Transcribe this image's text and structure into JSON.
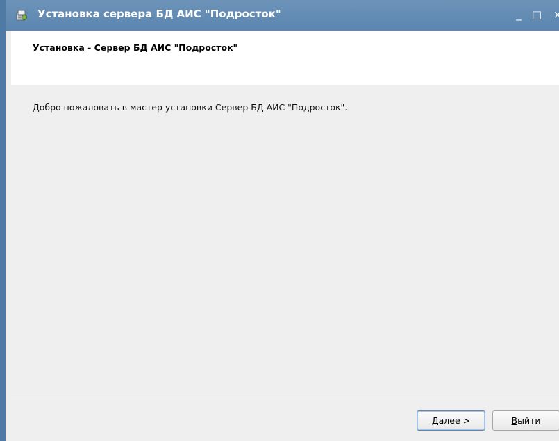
{
  "window": {
    "title": "Установка сервера БД АИС \"Подросток\"",
    "controls": {
      "minimize": "_",
      "maximize": "□",
      "close": "×"
    },
    "icon": "installer-app-icon"
  },
  "header": {
    "title": "Установка - Сервер БД АИС \"Подросток\""
  },
  "body": {
    "welcome": "Добро пожаловать в мастер установки Сервер БД АИС \"Подросток\"."
  },
  "buttons": {
    "next": {
      "accel": "Д",
      "rest": "алее >"
    },
    "exit": {
      "accel": "В",
      "rest": "ыйти"
    }
  },
  "colors": {
    "titlebar": "#5b86b0",
    "window_background": "#efefef",
    "header_background": "#ffffff",
    "default_button_border": "#5e88b8"
  }
}
